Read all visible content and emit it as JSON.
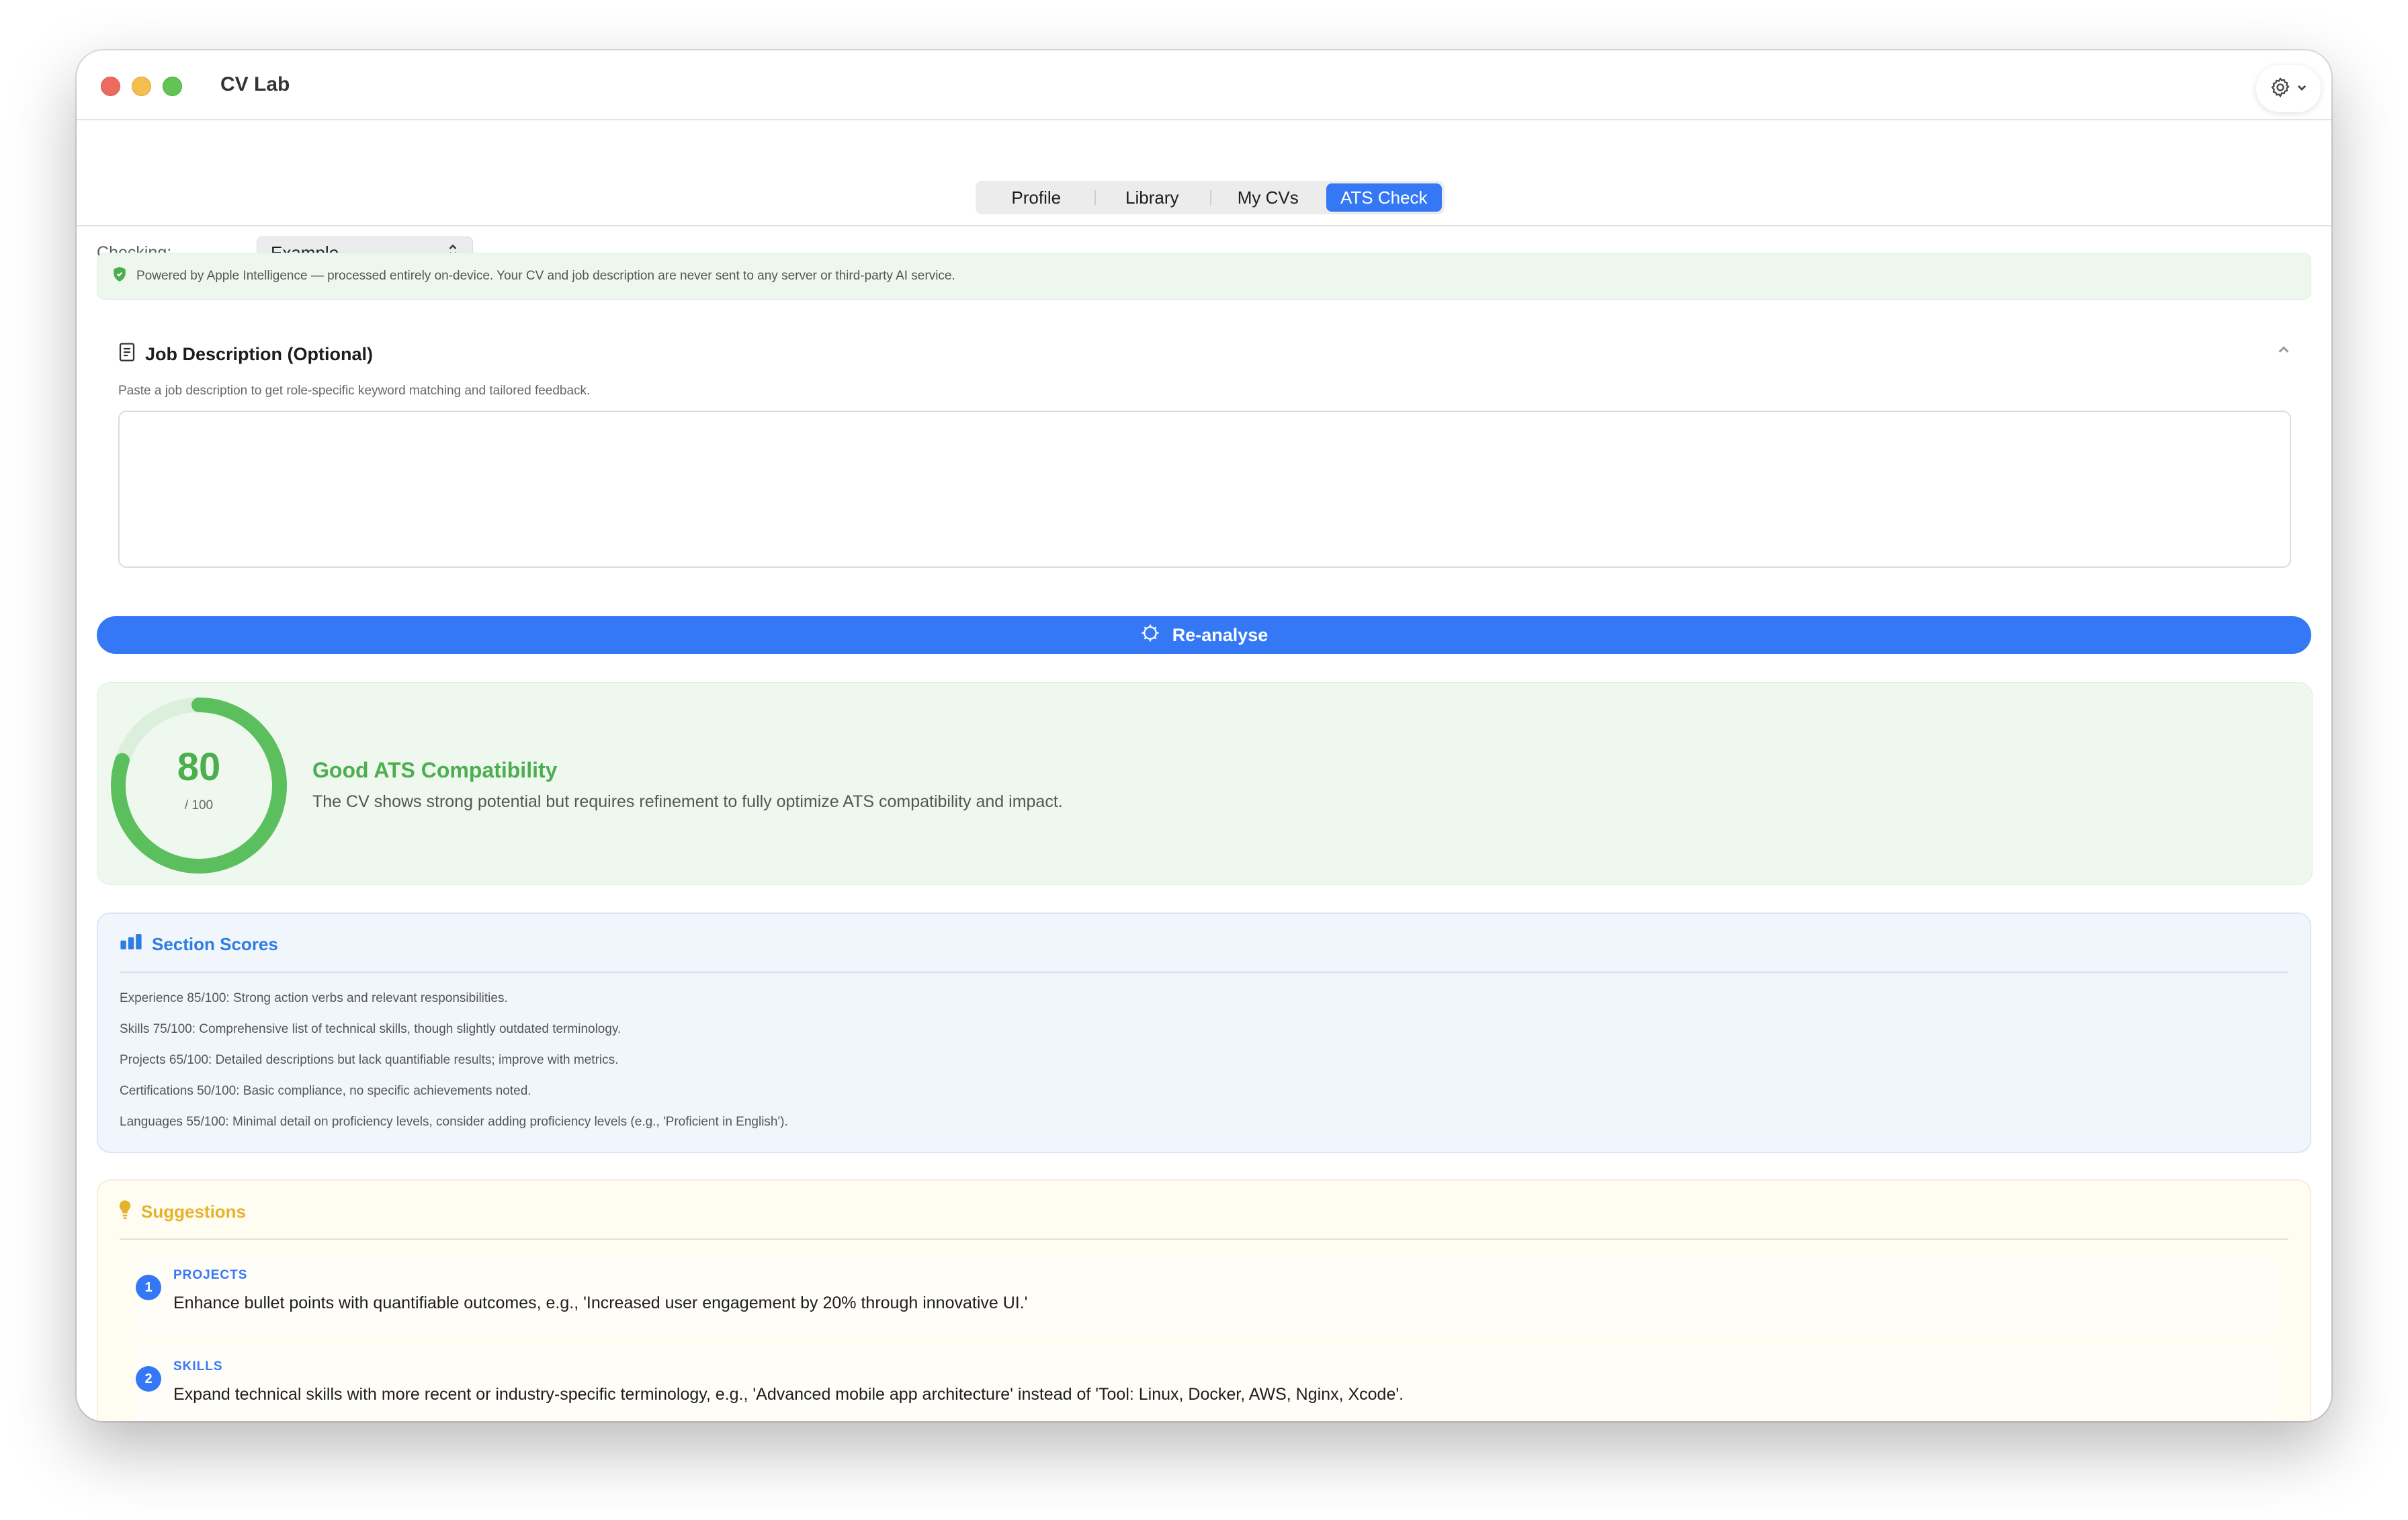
{
  "window": {
    "title": "CV Lab"
  },
  "tabs": [
    {
      "label": "Profile",
      "active": false
    },
    {
      "label": "Library",
      "active": false
    },
    {
      "label": "My CVs",
      "active": false
    },
    {
      "label": "ATS Check",
      "active": true
    }
  ],
  "checking": {
    "label": "Checking:",
    "value": "Example"
  },
  "banner": {
    "text": "Powered by Apple Intelligence — processed entirely on-device. Your CV and job description are never sent to any server or third-party AI service."
  },
  "job_description": {
    "title": "Job Description (Optional)",
    "subtitle": "Paste a job description to get role-specific keyword matching and tailored feedback.",
    "value": ""
  },
  "reanalyse_button": {
    "label": "Re-analyse"
  },
  "score": {
    "value": "80",
    "max_label": "/ 100",
    "fraction": 0.8,
    "title": "Good ATS Compatibility",
    "description": "The CV shows strong potential but requires refinement to fully optimize ATS compatibility and impact.",
    "color": "#4cae4f"
  },
  "section_scores": {
    "title": "Section Scores",
    "lines": [
      "Experience 85/100: Strong action verbs and relevant responsibilities.",
      "Skills 75/100: Comprehensive list of technical skills, though slightly outdated terminology.",
      "Projects 65/100: Detailed descriptions but lack quantifiable results; improve with metrics.",
      "Certifications 50/100: Basic compliance, no specific achievements noted.",
      "Languages 55/100: Minimal detail on proficiency levels, consider adding proficiency levels (e.g., 'Proficient in English')."
    ]
  },
  "suggestions": {
    "title": "Suggestions",
    "items": [
      {
        "num": "1",
        "category": "PROJECTS",
        "text": "Enhance bullet points with quantifiable outcomes, e.g., 'Increased user engagement by 20% through innovative UI.'"
      },
      {
        "num": "2",
        "category": "SKILLS",
        "text": "Expand technical skills with more recent or industry-specific terminology, e.g., 'Advanced mobile app architecture' instead of 'Tool: Linux, Docker, AWS, Nginx, Xcode'."
      }
    ]
  },
  "colors": {
    "accent": "#3478f6",
    "success": "#4cae4f",
    "section_accent": "#2d7ee0",
    "suggestion_accent": "#e5b32b"
  }
}
